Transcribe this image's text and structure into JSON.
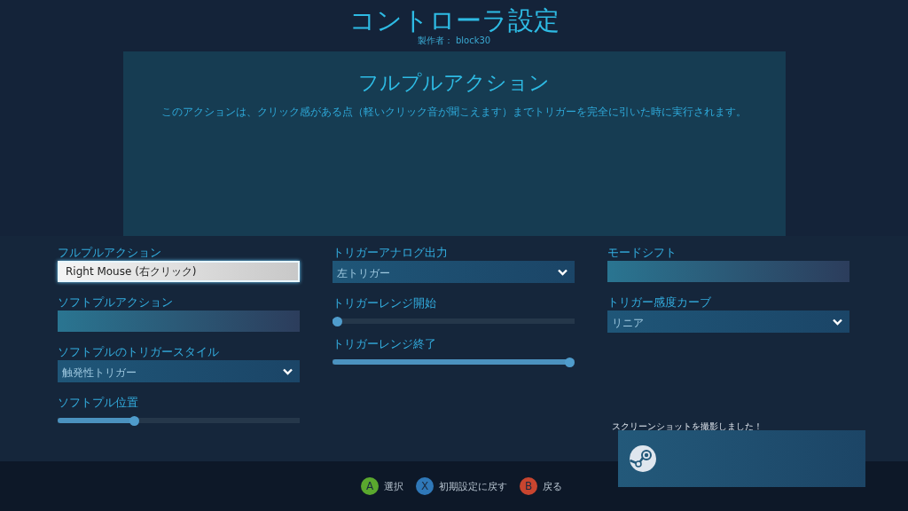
{
  "header": {
    "title": "コントローラ設定",
    "author": "製作者： block30"
  },
  "info_panel": {
    "title": "フルプルアクション",
    "description": "このアクションは、クリック感がある点（軽いクリック音が聞こえます）までトリガーを完全に引いた時に実行されます。"
  },
  "columns": [
    {
      "items": [
        {
          "label": "フルプルアクション",
          "kind": "binding",
          "value": "Right Mouse (右クリック)",
          "focused": true
        },
        {
          "label": "ソフトプルアクション",
          "kind": "binding",
          "focused": false
        },
        {
          "label": "ソフトプルのトリガースタイル",
          "kind": "dropdown",
          "value": "触発性トリガー"
        },
        {
          "label": "ソフトプル位置",
          "kind": "slider",
          "level": 0.31
        }
      ]
    },
    {
      "items": [
        {
          "label": "トリガーアナログ出力",
          "kind": "dropdown",
          "value": "左トリガー"
        },
        {
          "label": "トリガーレンジ開始",
          "kind": "slider",
          "level": 0.0
        },
        {
          "label": "トリガーレンジ終了",
          "kind": "slider",
          "level": 1.0
        }
      ]
    },
    {
      "items": [
        {
          "label": "モードシフト",
          "kind": "binding",
          "focused": false
        },
        {
          "label": "トリガー感度カーブ",
          "kind": "dropdown",
          "value": "リニア"
        }
      ]
    }
  ],
  "footer_hints": [
    {
      "key": "A",
      "label": "選択",
      "color": "#5aa82e"
    },
    {
      "key": "X",
      "label": "初期設定に戻す",
      "color": "#2f78b8"
    },
    {
      "key": "B",
      "label": "戻る",
      "color": "#c8452f"
    }
  ],
  "notification": {
    "message": "スクリーンショットを撮影しました！"
  }
}
